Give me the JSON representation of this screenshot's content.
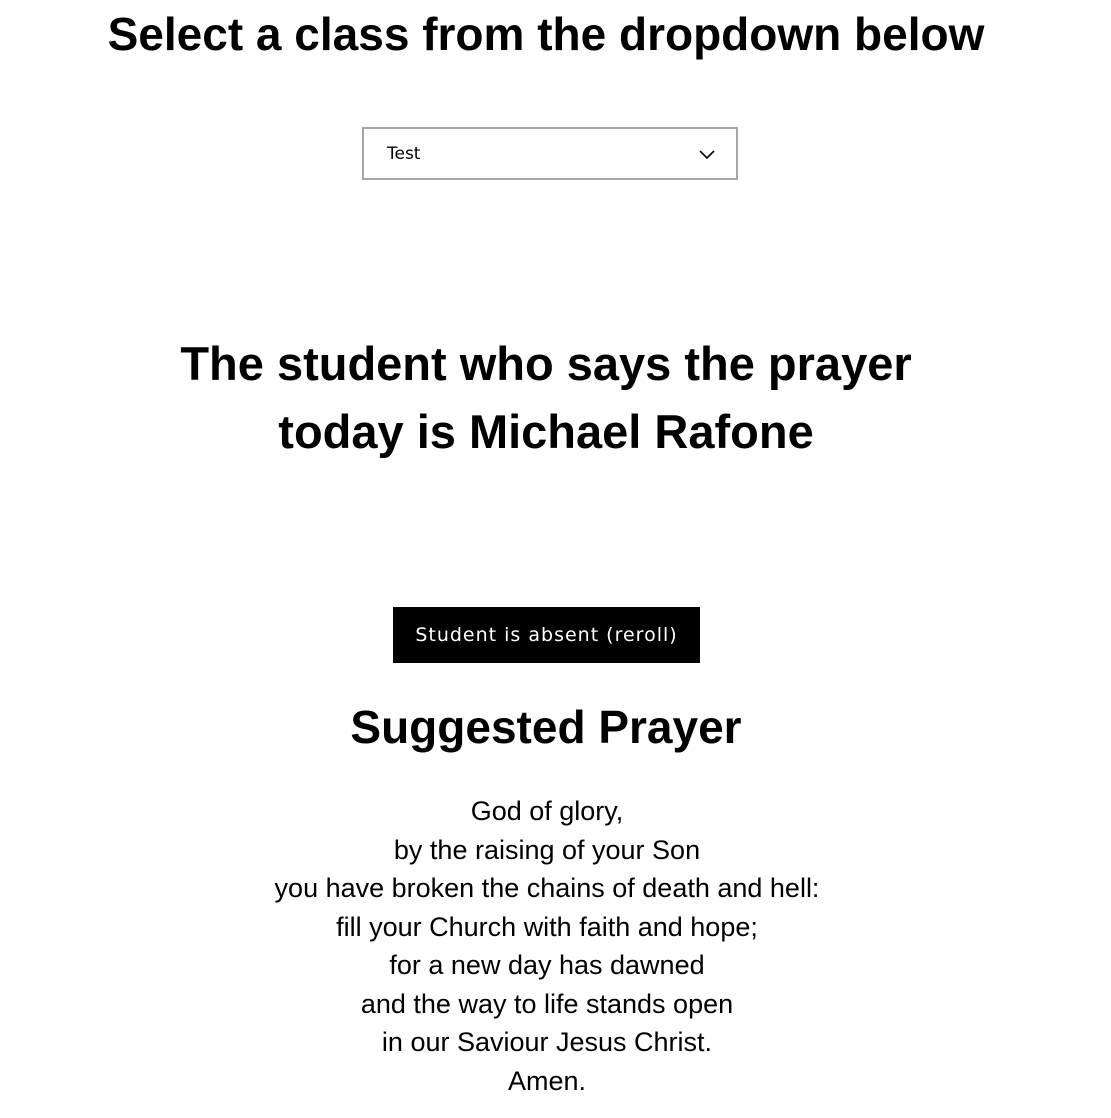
{
  "header": {
    "title": "Select a class from the dropdown below"
  },
  "class_select": {
    "selected_value": "Test",
    "icon": "chevron-down-icon"
  },
  "announcement": {
    "lines": [
      "The student who says the prayer",
      "today is Michael Rafone"
    ]
  },
  "reroll_button": {
    "label": "Student is absent (reroll)"
  },
  "prayer": {
    "title": "Suggested Prayer",
    "lines": [
      "God of glory,",
      "by the raising of your Son",
      "you have broken the chains of death and hell:",
      "fill your Church with faith and hope;",
      "for a new day has dawned",
      "and the way to life stands open",
      "in our Saviour Jesus Christ.",
      "Amen."
    ]
  },
  "colors": {
    "text": "#000000",
    "background": "#ffffff",
    "button_bg": "#000000",
    "button_text": "#ffffff",
    "dropdown_border": "#a6a6a6"
  }
}
